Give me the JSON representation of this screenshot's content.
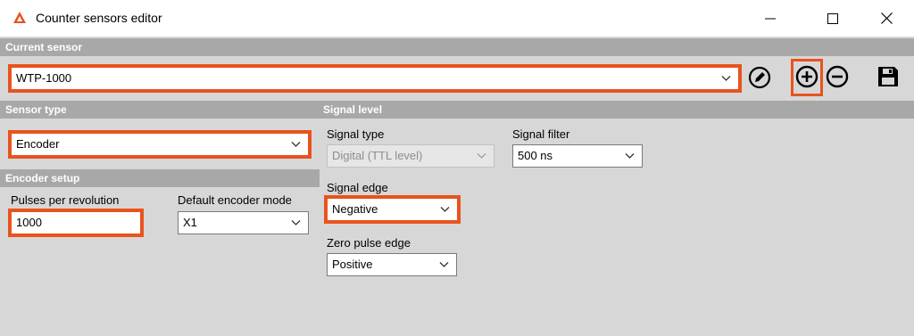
{
  "window": {
    "title": "Counter sensors editor",
    "icons": {
      "app": "dewesoft-logo-icon",
      "minimize": "minimize-icon",
      "maximize": "maximize-icon",
      "close": "close-icon"
    },
    "accent_color": "#e8531e"
  },
  "current_sensor": {
    "header": "Current sensor",
    "selected": "WTP-1000",
    "actions": {
      "edit_icon": "pencil-circle-icon",
      "add_icon": "plus-circle-icon",
      "remove_icon": "minus-circle-icon",
      "save_icon": "save-icon"
    }
  },
  "sensor_type": {
    "header": "Sensor type",
    "selected": "Encoder"
  },
  "encoder_setup": {
    "header": "Encoder setup",
    "pulses_label": "Pulses per revolution",
    "pulses_value": "1000",
    "mode_label": "Default encoder mode",
    "mode_value": "X1"
  },
  "signal_level": {
    "header": "Signal level",
    "signal_type_label": "Signal type",
    "signal_type_value": "Digital (TTL level)",
    "signal_filter_label": "Signal filter",
    "signal_filter_value": "500 ns",
    "signal_edge_label": "Signal edge",
    "signal_edge_value": "Negative",
    "zero_pulse_label": "Zero pulse edge",
    "zero_pulse_value": "Positive"
  }
}
